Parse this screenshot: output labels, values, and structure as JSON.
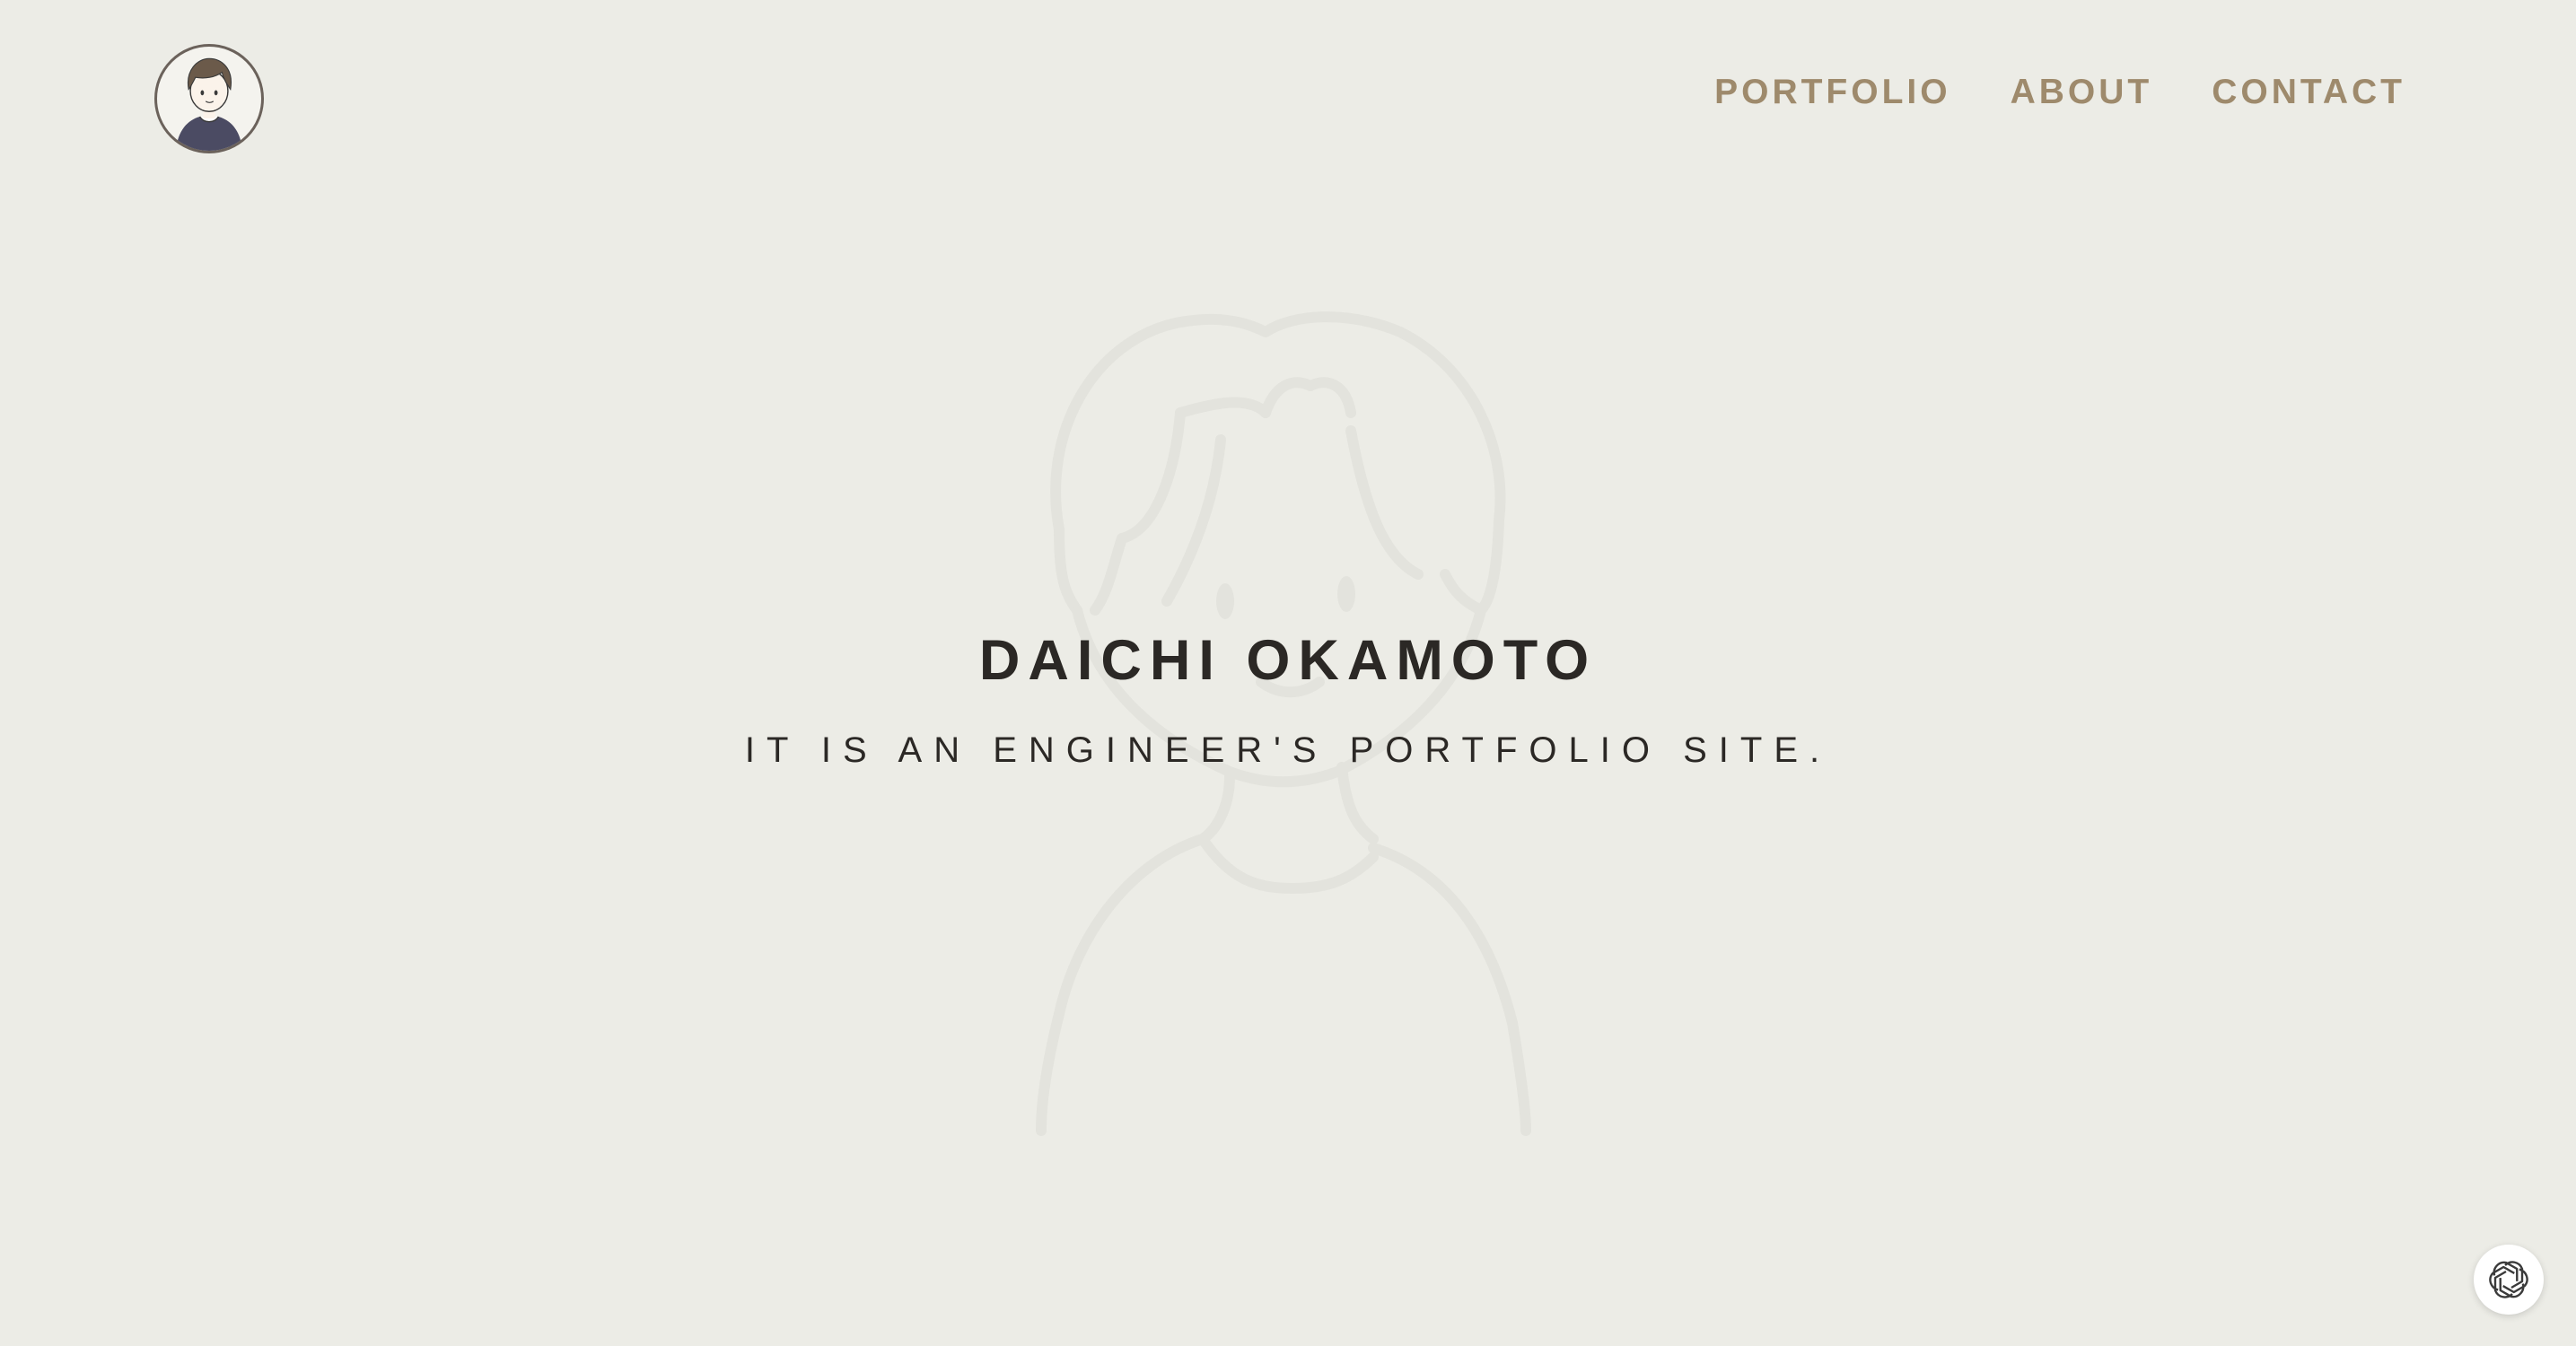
{
  "header": {
    "nav": [
      {
        "label": "PORTFOLIO"
      },
      {
        "label": "ABOUT"
      },
      {
        "label": "CONTACT"
      }
    ]
  },
  "hero": {
    "title": "DAICHI OKAMOTO",
    "subtitle": "IT IS AN ENGINEER'S PORTFOLIO SITE."
  },
  "colors": {
    "background": "#ecece6",
    "nav_text": "#9e8a6c",
    "hero_text": "#2b2825",
    "illustration_stroke": "#e4e4de"
  },
  "icons": {
    "logo": "avatar-icon",
    "chat": "chatgpt-icon"
  }
}
